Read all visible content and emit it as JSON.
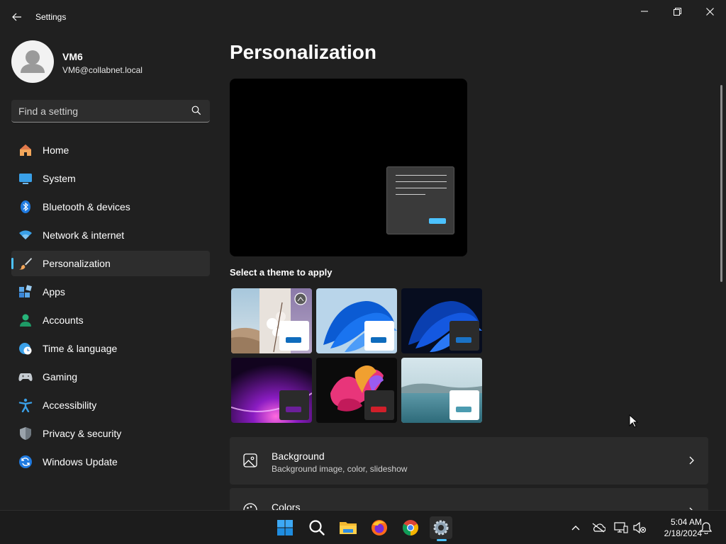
{
  "window": {
    "title": "Settings",
    "controls": {
      "minimize": "minimize",
      "maximize": "restore",
      "close": "close"
    }
  },
  "profile": {
    "name": "VM6",
    "email": "VM6@collabnet.local"
  },
  "search": {
    "placeholder": "Find a setting"
  },
  "sidebar": {
    "items": [
      {
        "label": "Home",
        "icon": "home-icon"
      },
      {
        "label": "System",
        "icon": "system-icon"
      },
      {
        "label": "Bluetooth & devices",
        "icon": "bluetooth-icon"
      },
      {
        "label": "Network & internet",
        "icon": "network-icon"
      },
      {
        "label": "Personalization",
        "icon": "brush-icon",
        "selected": true
      },
      {
        "label": "Apps",
        "icon": "apps-icon"
      },
      {
        "label": "Accounts",
        "icon": "accounts-icon"
      },
      {
        "label": "Time & language",
        "icon": "clock-globe-icon"
      },
      {
        "label": "Gaming",
        "icon": "gamepad-icon"
      },
      {
        "label": "Accessibility",
        "icon": "accessibility-icon"
      },
      {
        "label": "Privacy & security",
        "icon": "shield-icon"
      },
      {
        "label": "Windows Update",
        "icon": "update-icon"
      }
    ]
  },
  "main": {
    "title": "Personalization",
    "themes_heading": "Select a theme to apply",
    "themes": [
      {
        "name": "spotlight",
        "accent": "#0f6cbd",
        "card": "#ffffff"
      },
      {
        "name": "windows-light",
        "accent": "#0f6cbd",
        "card": "#ffffff"
      },
      {
        "name": "windows-dark",
        "accent": "#1a72c5",
        "card": "#2b2b2b"
      },
      {
        "name": "glow",
        "accent": "#6b1f9a",
        "card": "#2b2b2b"
      },
      {
        "name": "captured-motion",
        "accent": "#d11f2a",
        "card": "#2b2b2b"
      },
      {
        "name": "flow",
        "accent": "#4b9bb0",
        "card": "#ffffff"
      }
    ],
    "rows": [
      {
        "title": "Background",
        "subtitle": "Background image, color, slideshow",
        "icon": "picture-icon"
      },
      {
        "title": "Colors",
        "subtitle": "",
        "icon": "palette-icon"
      }
    ]
  },
  "taskbar": {
    "apps": [
      "start-icon",
      "search-icon",
      "file-explorer-icon",
      "firefox-icon",
      "chrome-icon",
      "settings-icon"
    ],
    "active_app": "settings-icon",
    "time": "5:04 AM",
    "date": "2/18/2024"
  },
  "colors": {
    "accent": "#4cc2ff",
    "background": "#202020",
    "card": "#2b2b2b"
  }
}
